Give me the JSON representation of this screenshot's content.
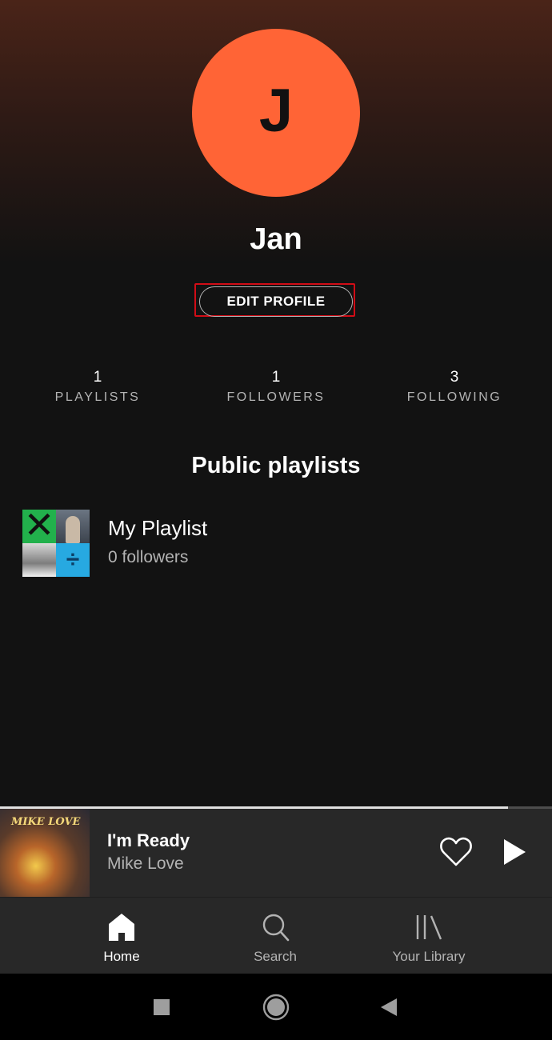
{
  "profile": {
    "avatar_initial": "J",
    "avatar_color": "#ff6436",
    "name": "Jan",
    "edit_label": "EDIT PROFILE"
  },
  "stats": [
    {
      "value": "1",
      "label": "PLAYLISTS"
    },
    {
      "value": "1",
      "label": "FOLLOWERS"
    },
    {
      "value": "3",
      "label": "FOLLOWING"
    }
  ],
  "public_playlists": {
    "title": "Public playlists",
    "items": [
      {
        "name": "My Playlist",
        "followers": "0 followers"
      }
    ]
  },
  "now_playing": {
    "title": "I'm Ready",
    "artist": "Mike Love",
    "art_text": "MIKE LOVE",
    "progress_fraction": 0.92
  },
  "tabs": [
    {
      "label": "Home",
      "icon": "home-icon",
      "active": true
    },
    {
      "label": "Search",
      "icon": "search-icon",
      "active": false
    },
    {
      "label": "Your Library",
      "icon": "library-icon",
      "active": false
    }
  ],
  "colors": {
    "background": "#121212",
    "highlight_box": "#d10c16",
    "player_bar": "#282828"
  }
}
